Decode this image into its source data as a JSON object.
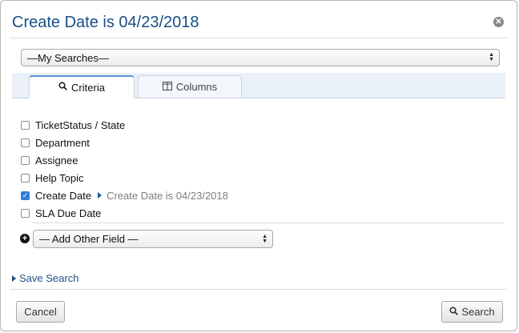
{
  "dialog": {
    "title": "Create Date is 04/23/2018",
    "close_icon": "close-circle-icon"
  },
  "saved_searches": {
    "selected": "—My Searches—"
  },
  "tabs": [
    {
      "label": "Criteria",
      "icon": "search-icon",
      "active": true
    },
    {
      "label": "Columns",
      "icon": "columns-icon",
      "active": false
    }
  ],
  "fields": [
    {
      "label": "TicketStatus / State",
      "checked": false
    },
    {
      "label": "Department",
      "checked": false
    },
    {
      "label": "Assignee",
      "checked": false
    },
    {
      "label": "Help Topic",
      "checked": false
    },
    {
      "label": "Create Date",
      "checked": true,
      "criteria": "Create Date is 04/23/2018"
    },
    {
      "label": "SLA Due Date",
      "checked": false
    }
  ],
  "add_field": {
    "selected": "— Add Other Field —"
  },
  "save_search": {
    "label": "Save Search"
  },
  "buttons": {
    "cancel": "Cancel",
    "search": "Search"
  },
  "colors": {
    "title": "#184e87",
    "link": "#1d4f86",
    "checkbox_checked": "#2f7ed8"
  }
}
